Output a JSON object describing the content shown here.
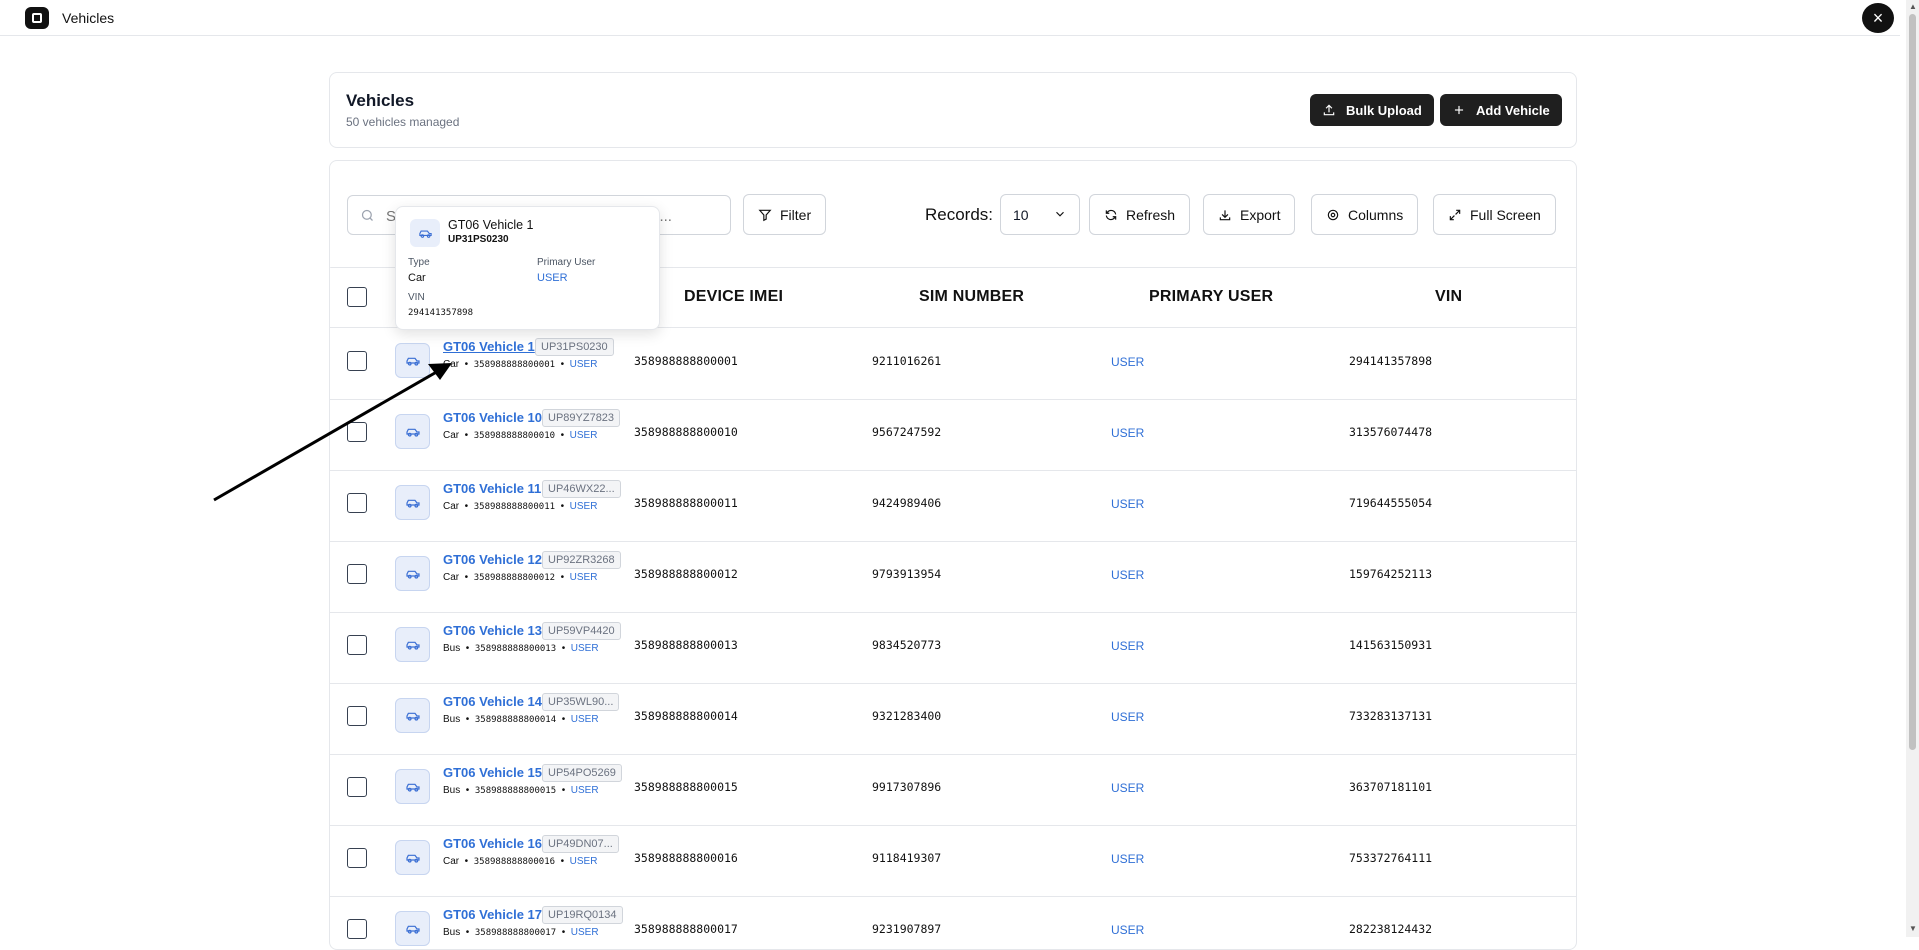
{
  "window": {
    "title": "Vehicles",
    "close_label": "×"
  },
  "header": {
    "title": "Vehicles",
    "subtitle": "50 vehicles managed",
    "bulk_upload_label": "Bulk Upload",
    "add_vehicle_label": "Add Vehicle"
  },
  "toolbar": {
    "search_placeholder": "Search by name, plate, IMEI, department...",
    "filter_label": "Filter",
    "records_label": "Records:",
    "records_value": "10",
    "refresh_label": "Refresh",
    "export_label": "Export",
    "columns_label": "Columns",
    "fullscreen_label": "Full Screen"
  },
  "table": {
    "headers": [
      "DEVICE IMEI",
      "SIM NUMBER",
      "PRIMARY USER",
      "VIN"
    ],
    "rows": [
      {
        "name": "GT06 Vehicle 1",
        "plate": "UP31PS0230",
        "type": "Car",
        "imei": "358988888800001",
        "sim": "9211016261",
        "user": "USER",
        "vin": "294141357898"
      },
      {
        "name": "GT06 Vehicle 10",
        "plate": "UP89YZ7823",
        "type": "Car",
        "imei": "358988888800010",
        "sim": "9567247592",
        "user": "USER",
        "vin": "313576074478"
      },
      {
        "name": "GT06 Vehicle 11",
        "plate": "UP46WX22...",
        "type": "Car",
        "imei": "358988888800011",
        "sim": "9424989406",
        "user": "USER",
        "vin": "719644555054"
      },
      {
        "name": "GT06 Vehicle 12",
        "plate": "UP92ZR3268",
        "type": "Car",
        "imei": "358988888800012",
        "sim": "9793913954",
        "user": "USER",
        "vin": "159764252113"
      },
      {
        "name": "GT06 Vehicle 13",
        "plate": "UP59VP4420",
        "type": "Bus",
        "imei": "358988888800013",
        "sim": "9834520773",
        "user": "USER",
        "vin": "141563150931"
      },
      {
        "name": "GT06 Vehicle 14",
        "plate": "UP35WL90...",
        "type": "Bus",
        "imei": "358988888800014",
        "sim": "9321283400",
        "user": "USER",
        "vin": "733283137131"
      },
      {
        "name": "GT06 Vehicle 15",
        "plate": "UP54PO5269",
        "type": "Bus",
        "imei": "358988888800015",
        "sim": "9917307896",
        "user": "USER",
        "vin": "363707181101"
      },
      {
        "name": "GT06 Vehicle 16",
        "plate": "UP49DN07...",
        "type": "Car",
        "imei": "358988888800016",
        "sim": "9118419307",
        "user": "USER",
        "vin": "753372764111"
      },
      {
        "name": "GT06 Vehicle 17",
        "plate": "UP19RQ0134",
        "type": "Bus",
        "imei": "358988888800017",
        "sim": "9231907897",
        "user": "USER",
        "vin": "282238124432"
      }
    ]
  },
  "tooltip": {
    "name": "GT06 Vehicle 1",
    "plate": "UP31PS0230",
    "type_label": "Type",
    "type_value": "Car",
    "user_label": "Primary User",
    "user_value": "USER",
    "vin_label": "VIN",
    "vin_value": "294141357898"
  }
}
